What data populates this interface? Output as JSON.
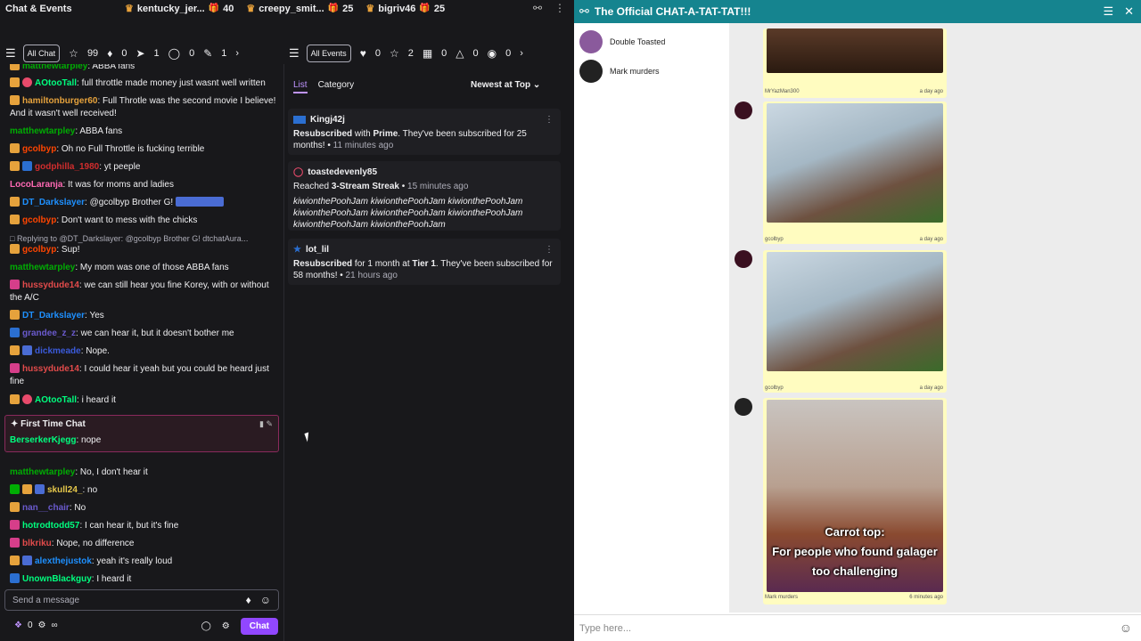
{
  "topbar": {
    "title": "Chat & Events",
    "gifters": [
      {
        "name": "kentucky_jer...",
        "count": "40",
        "icon": "crown-gift"
      },
      {
        "name": "creepy_smit...",
        "count": "25",
        "icon": "crown-gift"
      },
      {
        "name": "bigriv46",
        "count": "25",
        "icon": "crown-gift"
      }
    ]
  },
  "chat_filters": {
    "all": "All Chat",
    "stars": "99",
    "bits": "0",
    "raid": "1",
    "shield": "0",
    "pin": "1"
  },
  "event_filters": {
    "all": "All Events",
    "hearts": "0",
    "stars": "2",
    "gifts": "0",
    "raids": "0",
    "other": "0"
  },
  "chat": [
    {
      "user": "matthewtarpley",
      "color": "#00ad03",
      "text": "ABBA fans"
    },
    {
      "user": "AOtooTall",
      "color": "#00ff7f",
      "text": "full throttle made money just wasnt well written"
    },
    {
      "user": "hamiltonburger60",
      "color": "#e6a23c",
      "text": "Full Throtle was the second movie I believe! And it wasn't well received!"
    },
    {
      "user": "matthewtarpley",
      "color": "#00ad03",
      "text": "ABBA fans"
    },
    {
      "user": "gcolbyp",
      "color": "#ff4500",
      "text": "Oh no Full Throttle is fucking terrible"
    },
    {
      "user": "godphilla_1980",
      "color": "#d12d2d",
      "text": "yt peeple"
    },
    {
      "user": "LocoLaranja",
      "color": "#ff69b4",
      "text": "It was for moms and ladies"
    },
    {
      "user": "DT_Darkslayer",
      "color": "#1e90ff",
      "text": "@gcolbyp Brother G!"
    },
    {
      "user": "gcolbyp",
      "color": "#ff4500",
      "text": "Don't want to mess with the chicks"
    },
    {
      "reply": "Replying to @DT_Darkslayer: @gcolbyp Brother G! dtchatAura..."
    },
    {
      "user": "gcolbyp",
      "color": "#ff4500",
      "text": "Sup!"
    },
    {
      "user": "matthewtarpley",
      "color": "#00ad03",
      "text": "My mom was one of those ABBA fans"
    },
    {
      "user": "hussydude14",
      "color": "#e24b4b",
      "text": "we can still hear you fine Korey, with or without the A/C"
    },
    {
      "user": "DT_Darkslayer",
      "color": "#1e90ff",
      "text": "Yes"
    },
    {
      "user": "grandee_z_z",
      "color": "#6a5acd",
      "text": "we can hear it, but it doesn't bother me"
    },
    {
      "user": "dickmeade",
      "color": "#3b5bdb",
      "text": "Nope."
    },
    {
      "user": "hussydude14",
      "color": "#e24b4b",
      "text": "I could hear it yeah but you could be heard just fine"
    },
    {
      "user": "AOtooTall",
      "color": "#00ff7f",
      "text": "i heard it"
    },
    {
      "first_time_label": "First Time Chat",
      "user": "BerserkerKjegg",
      "color": "#00ff7f",
      "text": "nope"
    },
    {
      "user": "matthewtarpley",
      "color": "#00ad03",
      "text": "No, I don't hear it"
    },
    {
      "user": "skull24_",
      "color": "#e6c84b",
      "text": "no"
    },
    {
      "user": "nan__chair",
      "color": "#6a5acd",
      "text": "No"
    },
    {
      "user": "hotrodtodd57",
      "color": "#00ff7f",
      "text": "I can hear it, but it's fine"
    },
    {
      "user": "blkriku",
      "color": "#e24b4b",
      "text": "Nope, no difference"
    },
    {
      "user": "alexthejustok",
      "color": "#1e90ff",
      "text": "yeah it's really loud"
    },
    {
      "user": "UnownBlackguy",
      "color": "#00ff7f",
      "text": "I heard it"
    }
  ],
  "sendbox": {
    "placeholder": "Send a message"
  },
  "bottombar": {
    "points": "0",
    "chat_button": "Chat"
  },
  "events": {
    "tab_list": "List",
    "tab_category": "Category",
    "sort": "Newest at Top",
    "items": [
      {
        "user": "Kingj42j",
        "action": "Resubscribed",
        "mid": " with ",
        "tier": "Prime",
        "rest": ". They've been subscribed for 25 months!",
        "time": "11 minutes ago"
      },
      {
        "user": "toastedevenly85",
        "action": "Reached ",
        "tier": "3-Stream Streak",
        "time": "15 minutes ago",
        "emotes": "kiwionthePoohJam kiwionthePoohJam kiwionthePoohJam kiwionthePoohJam kiwionthePoohJam kiwionthePoohJam kiwionthePoohJam kiwionthePoohJam"
      },
      {
        "user": "lot_lil",
        "action": "Resubscribed",
        "mid": " for 1 month at ",
        "tier": "Tier 1",
        "rest": ". They've been subscribed for 58 months!",
        "time": "21 hours ago"
      }
    ]
  },
  "right": {
    "title": "The Official CHAT-A-TAT-TAT!!!",
    "members": [
      "Double Toasted",
      "Mark murders"
    ],
    "posts": [
      {
        "author": "MrYazMan300",
        "time": "a day ago"
      },
      {
        "author": "gcolbyp",
        "time": "a day ago"
      },
      {
        "author": "gcolbyp",
        "time": "a day ago"
      },
      {
        "author": "Mark murders",
        "time": "6 minutes ago",
        "caption": "Carrot top:\nFor people who found galager too challenging"
      }
    ],
    "type_placeholder": "Type here..."
  }
}
